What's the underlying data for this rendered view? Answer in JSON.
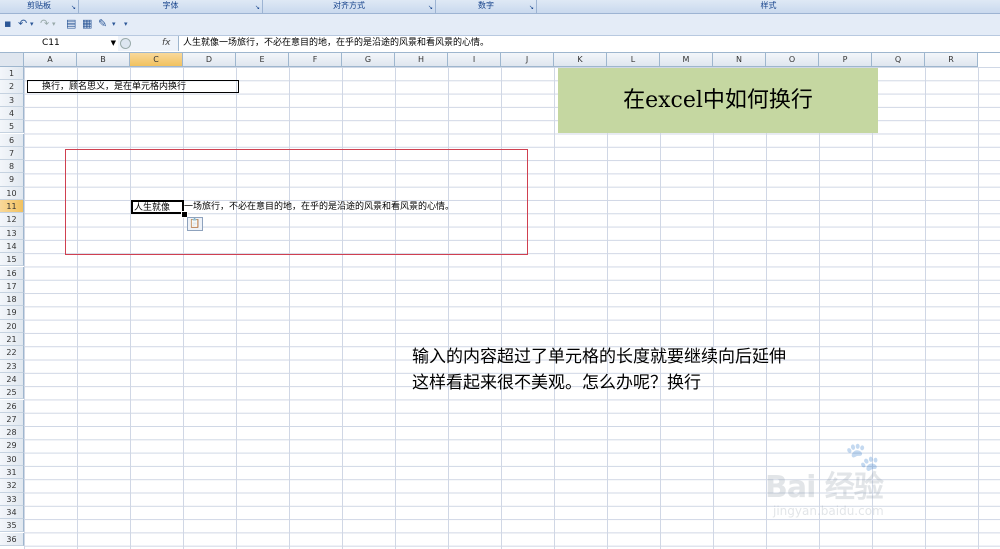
{
  "ribbon": {
    "groups": [
      "剪贴板",
      "字体",
      "对齐方式",
      "数字",
      "样式"
    ]
  },
  "formula_bar": {
    "name_box": "C11",
    "fx_label": "fx",
    "content": "人生就像一场旅行，不必在意目的地，在乎的是沿途的风景和看风景的心情。"
  },
  "grid": {
    "columns": [
      "A",
      "B",
      "C",
      "D",
      "E",
      "F",
      "G",
      "H",
      "I",
      "J",
      "K",
      "L",
      "M",
      "N",
      "O",
      "P",
      "Q",
      "R"
    ],
    "selected_column": "C",
    "rows": [
      "1",
      "2",
      "3",
      "4",
      "5",
      "6",
      "7",
      "8",
      "9",
      "10",
      "11",
      "12",
      "13",
      "14",
      "15",
      "16",
      "17",
      "18",
      "19",
      "20",
      "21",
      "22",
      "23",
      "24",
      "25",
      "26",
      "27",
      "28",
      "29",
      "30",
      "31",
      "32",
      "33",
      "34",
      "35",
      "36"
    ],
    "selected_row": "11"
  },
  "cells": {
    "a2": "换行，顾名思义，是在单元格内换行",
    "c11_visible": "人生就像",
    "c11_overflow": "一场旅行，不必在意目的地，在乎的是沿途的风景和看风景的心情。"
  },
  "callouts": {
    "title": "在excel中如何换行",
    "note_line1": "输入的内容超过了单元格的长度就要继续向后延伸",
    "note_line2": "这样看起来很不美观。怎么办呢？换行"
  },
  "watermark": {
    "brand": "Bai  经验",
    "url": "jingyan.baidu.com"
  },
  "colors": {
    "title_bg": "#c5d7a1",
    "highlight_border": "#d04050",
    "header_selected": "#f1c15f"
  }
}
